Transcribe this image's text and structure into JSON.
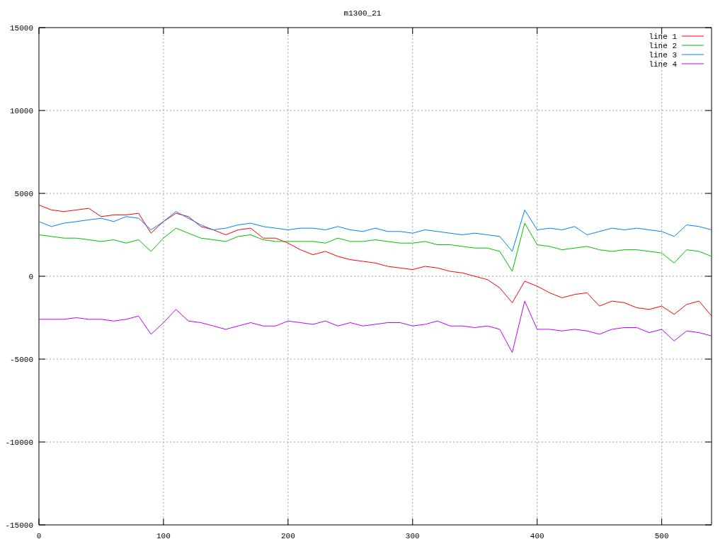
{
  "plot": {
    "chart_data": {
      "type": "line",
      "title": "m1300_21",
      "x": [
        0,
        10,
        20,
        30,
        40,
        50,
        60,
        70,
        80,
        90,
        100,
        110,
        120,
        130,
        140,
        150,
        160,
        170,
        180,
        190,
        200,
        210,
        220,
        230,
        240,
        250,
        260,
        270,
        280,
        290,
        300,
        310,
        320,
        330,
        340,
        350,
        360,
        370,
        380,
        390,
        400,
        410,
        420,
        430,
        440,
        450,
        460,
        470,
        480,
        490,
        500,
        510,
        520,
        530,
        540
      ],
      "series": [
        {
          "name": "line 1",
          "color": "#ff0000",
          "values": [
            4300,
            4000,
            3900,
            4000,
            4100,
            3600,
            3700,
            3700,
            3800,
            2600,
            3300,
            3800,
            3600,
            3000,
            2800,
            2500,
            2800,
            2900,
            2300,
            2300,
            2000,
            1600,
            1300,
            1500,
            1200,
            1000,
            900,
            800,
            600,
            500,
            400,
            600,
            500,
            300,
            200,
            0,
            -200,
            -700,
            -1600,
            -300,
            -600,
            -1000,
            -1300,
            -1100,
            -1000,
            -1800,
            -1500,
            -1600,
            -1900,
            -2000,
            -1800,
            -2300,
            -1700,
            -1500,
            -2400
          ]
        },
        {
          "name": "line 2",
          "color": "#00c000",
          "values": [
            2500,
            2400,
            2300,
            2300,
            2200,
            2100,
            2200,
            2000,
            2200,
            1500,
            2300,
            2900,
            2600,
            2300,
            2200,
            2100,
            2400,
            2500,
            2200,
            2100,
            2100,
            2100,
            2100,
            2000,
            2300,
            2100,
            2100,
            2200,
            2100,
            2000,
            2000,
            2100,
            1900,
            1900,
            1800,
            1700,
            1700,
            1500,
            300,
            3200,
            1900,
            1800,
            1600,
            1700,
            1800,
            1600,
            1500,
            1600,
            1600,
            1500,
            1400,
            800,
            1600,
            1500,
            1200
          ]
        },
        {
          "name": "line 3",
          "color": "#0080ff",
          "values": [
            3300,
            3000,
            3200,
            3300,
            3400,
            3500,
            3300,
            3600,
            3500,
            2800,
            3300,
            3900,
            3500,
            3100,
            2800,
            2900,
            3100,
            3200,
            3000,
            2900,
            2800,
            2900,
            2900,
            2800,
            3000,
            2800,
            2700,
            2900,
            2700,
            2700,
            2600,
            2800,
            2700,
            2600,
            2500,
            2600,
            2500,
            2400,
            1500,
            4000,
            2800,
            2900,
            2800,
            3000,
            2500,
            2700,
            2900,
            2800,
            2900,
            2800,
            2700,
            2400,
            3100,
            3000,
            2800
          ]
        },
        {
          "name": "line 4",
          "color": "#c000ff",
          "values": [
            -2600,
            -2600,
            -2600,
            -2500,
            -2600,
            -2600,
            -2700,
            -2600,
            -2400,
            -3500,
            -2800,
            -2000,
            -2700,
            -2800,
            -3000,
            -3200,
            -3000,
            -2800,
            -3000,
            -3000,
            -2700,
            -2800,
            -2900,
            -2700,
            -3000,
            -2800,
            -3000,
            -2900,
            -2800,
            -2800,
            -3000,
            -2900,
            -2700,
            -3000,
            -3000,
            -3100,
            -3000,
            -3200,
            -4600,
            -1500,
            -3200,
            -3200,
            -3300,
            -3200,
            -3300,
            -3500,
            -3200,
            -3100,
            -3100,
            -3400,
            -3200,
            -3900,
            -3300,
            -3400,
            -3600
          ]
        }
      ],
      "xlim": [
        0,
        540
      ],
      "ylim": [
        -15000,
        15000
      ],
      "xticks": [
        0,
        100,
        200,
        300,
        400,
        500
      ],
      "yticks": [
        -15000,
        -10000,
        -5000,
        0,
        5000,
        10000,
        15000
      ],
      "grid": true,
      "legend": true
    }
  }
}
